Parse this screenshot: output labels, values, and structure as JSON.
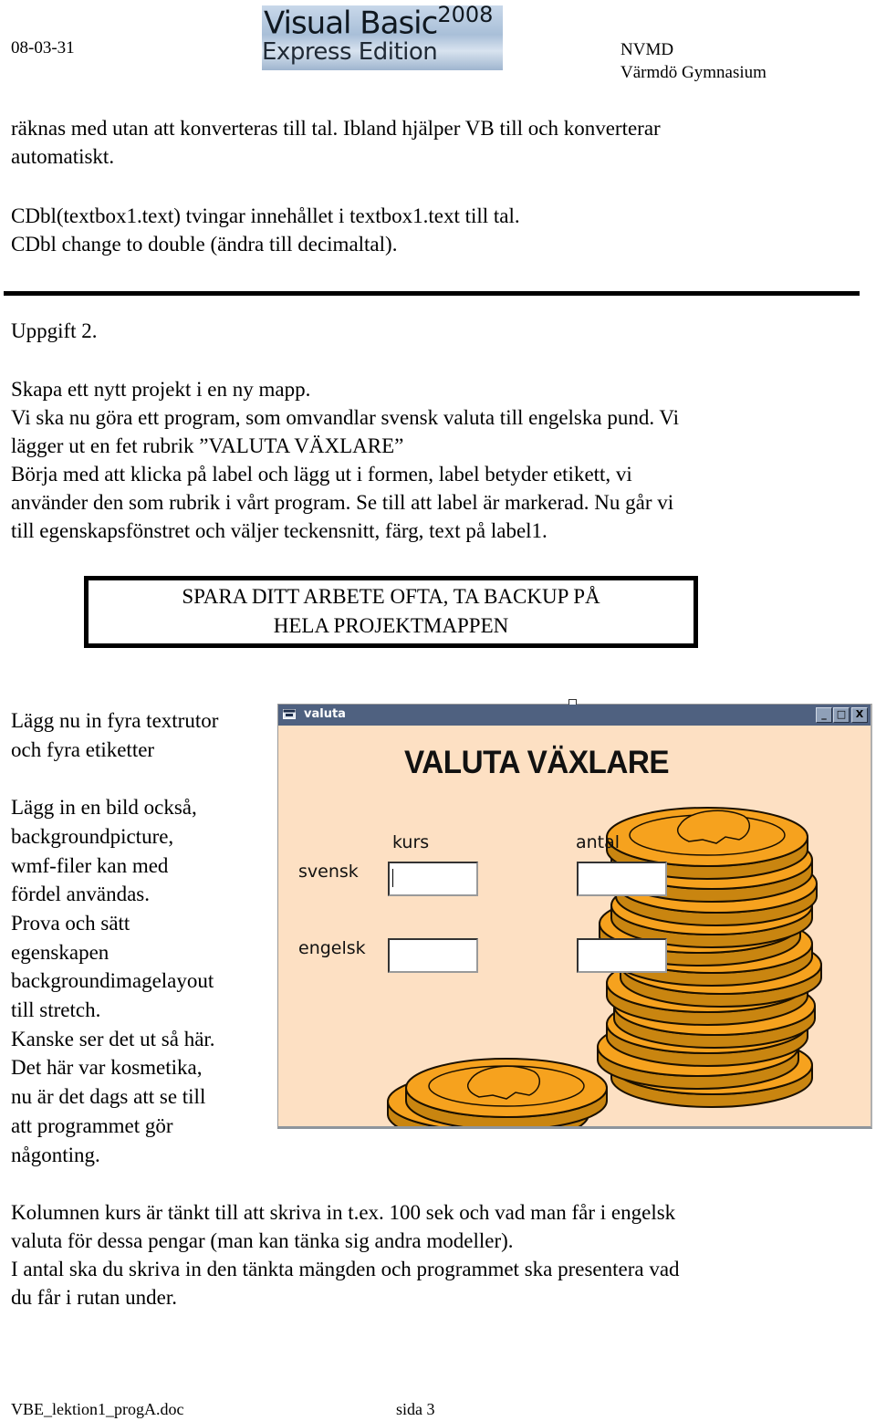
{
  "header": {
    "date": "08-03-31",
    "logo": {
      "line1": "Visual Basic",
      "version": "2008",
      "line2": "Express Edition"
    },
    "author": "NVMD",
    "school": "Värmdö Gymnasium"
  },
  "intro": {
    "lines": [
      "räknas med utan att konverteras till tal. Ibland hjälper VB till och konverterar",
      "automatiskt."
    ]
  },
  "cdbl": {
    "lines": [
      "CDbl(textbox1.text) tvingar innehållet i textbox1.text till tal.",
      "CDbl change to double (ändra till decimaltal)."
    ]
  },
  "task": {
    "heading": "Uppgift 2.",
    "lines": [
      "Skapa ett nytt projekt i en ny mapp.",
      "Vi ska nu göra ett program, som omvandlar svensk valuta till engelska pund. Vi",
      "lägger ut en fet rubrik ”VALUTA VÄXLARE”",
      "Börja med att klicka på label och lägg ut i formen, label betyder etikett, vi",
      "använder den som rubrik i vårt program. Se till att label är markerad. Nu går vi",
      "till egenskapsfönstret och väljer teckensnitt, färg, text på label1."
    ]
  },
  "notice": {
    "line1": "SPARA DITT ARBETE OFTA, TA BACKUP PÅ",
    "line2": "HELA PROJEKTMAPPEN"
  },
  "side_text": {
    "lines": [
      "Lägg nu in fyra textrutor",
      "och fyra etiketter",
      "",
      "Lägg in en bild också,",
      "backgroundpicture,",
      "wmf-filer kan med",
      "fördel användas.",
      "Prova och sätt",
      "egenskapen",
      "backgroundimagelayout",
      "till stretch.",
      "Kanske ser det ut så här.",
      "Det här var kosmetika,",
      "nu är det dags att se till",
      "att programmet gör",
      "någonting."
    ]
  },
  "vb_window": {
    "title": "valuta",
    "buttons": {
      "minimize": "_",
      "maximize": "□",
      "close": "X"
    },
    "heading": "VALUTA VÄXLARE",
    "col_labels": {
      "kurs": "kurs",
      "antal": "antal"
    },
    "row_labels": {
      "svensk": "svensk",
      "engelsk": "engelsk"
    },
    "fields": {
      "svensk_kurs": "",
      "svensk_antal": "",
      "engelsk_kurs": "",
      "engelsk_antal": ""
    },
    "colors": {
      "titlebar": "#4f6180",
      "form_bg": "#fde0c3",
      "coin": "#f6a21e",
      "coin_edge": "#c98510"
    }
  },
  "outro": {
    "lines": [
      "Kolumnen kurs är tänkt till att skriva in t.ex. 100 sek och vad man får i engelsk",
      "valuta för dessa pengar (man kan tänka sig andra modeller).",
      "I antal ska du skriva in den tänkta mängden och programmet ska presentera vad",
      "du får i rutan under."
    ]
  },
  "footer": {
    "filename": "VBE_lektion1_progA.doc",
    "page": "sida 3"
  }
}
